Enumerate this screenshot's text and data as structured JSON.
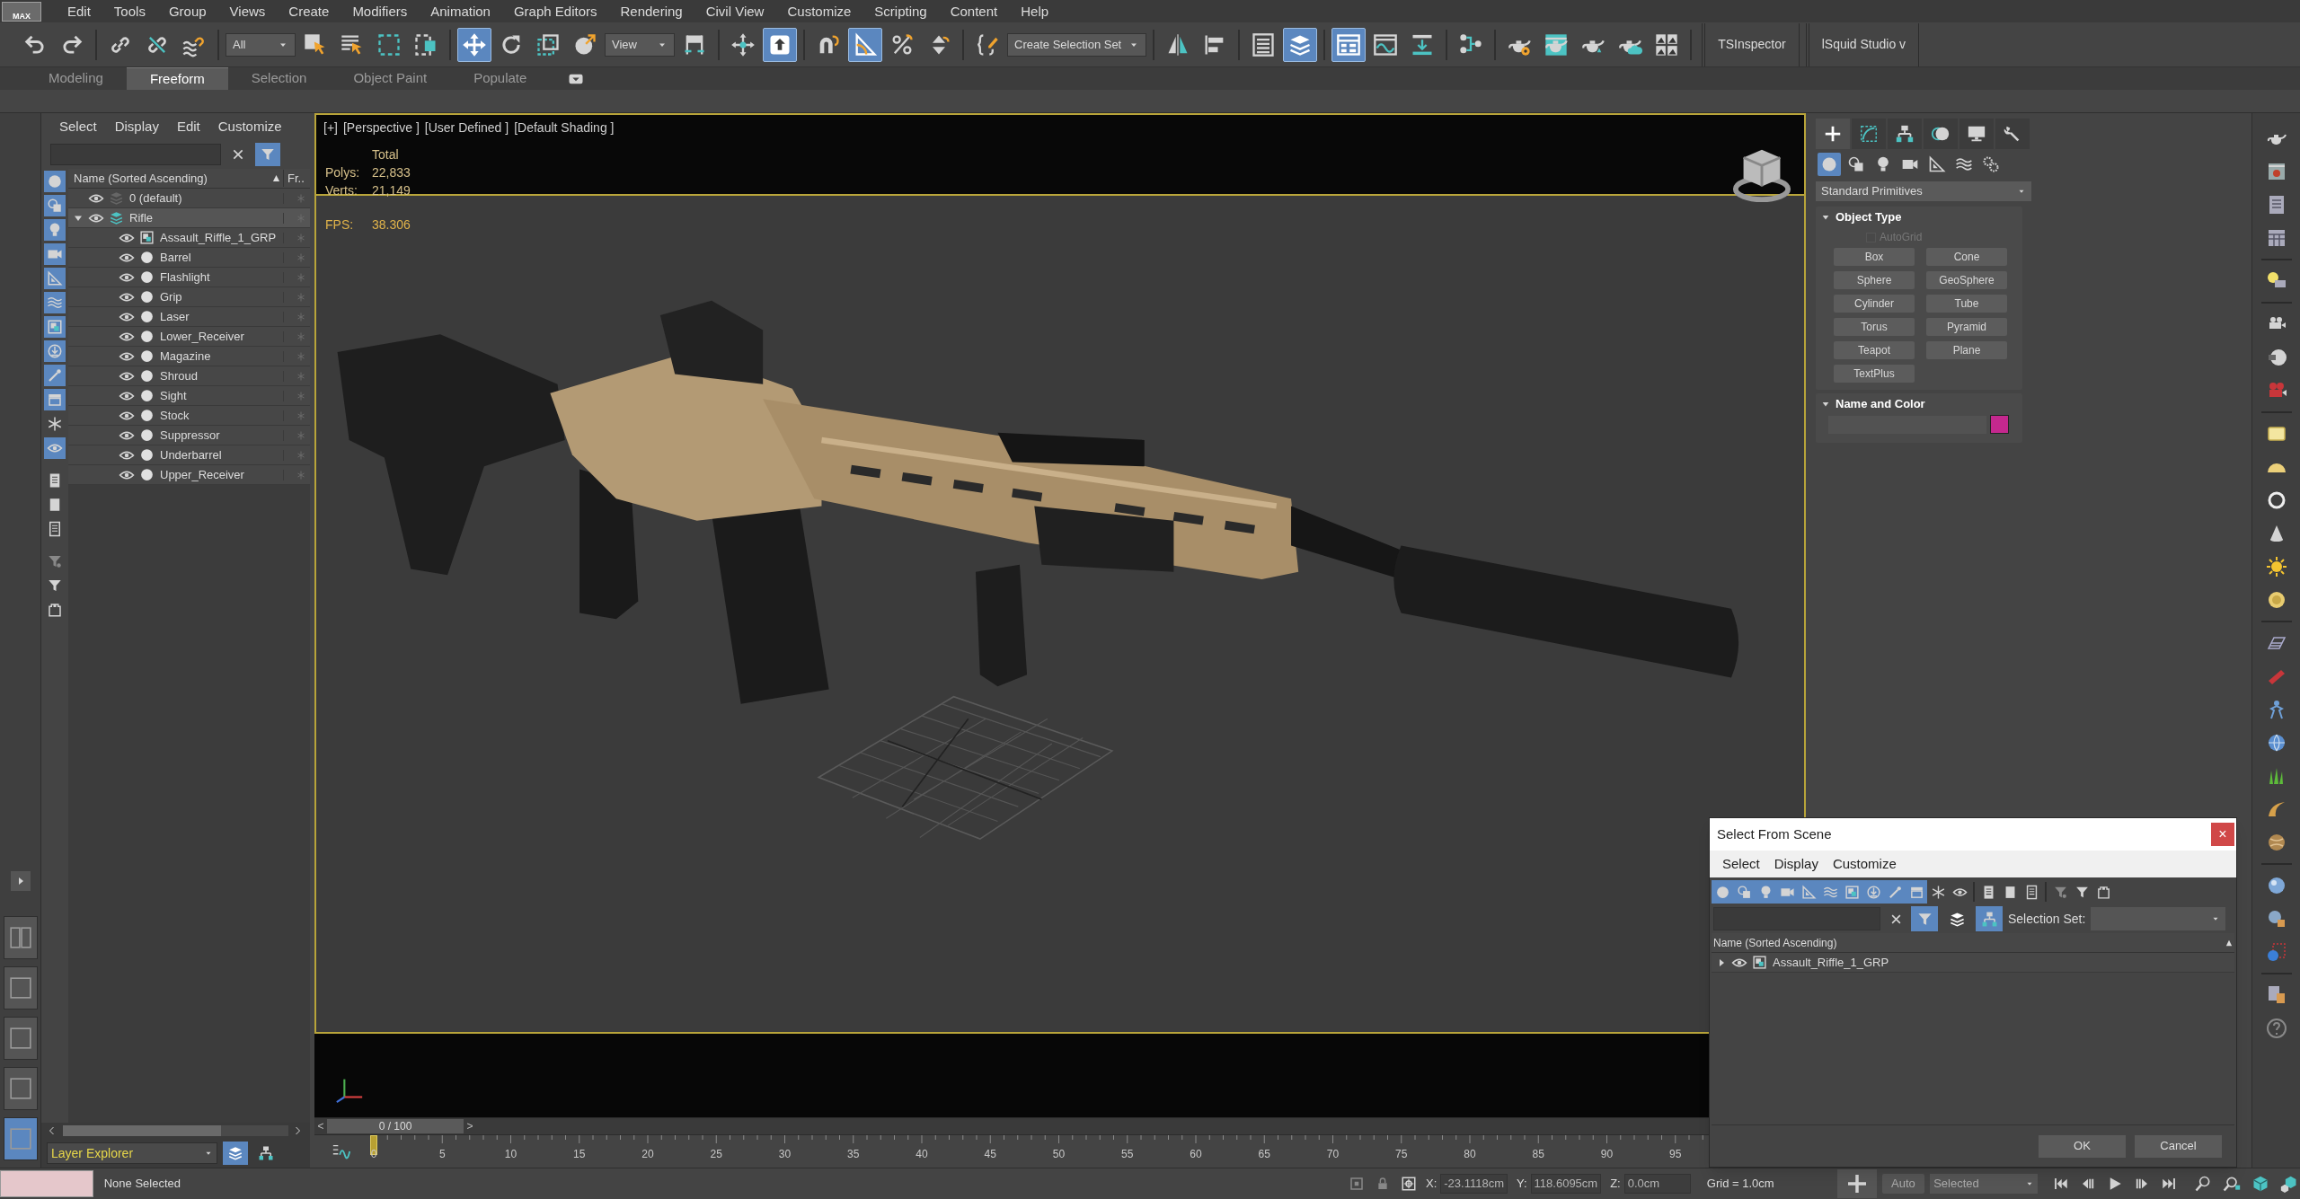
{
  "menu_bar": {
    "logo": "MAX",
    "items": [
      "Edit",
      "Tools",
      "Group",
      "Views",
      "Create",
      "Modifiers",
      "Animation",
      "Graph Editors",
      "Rendering",
      "Civil View",
      "Customize",
      "Scripting",
      "Content",
      "Help"
    ]
  },
  "main_toolbar": {
    "items": [
      {
        "kind": "undo",
        "active": false
      },
      {
        "kind": "redo",
        "active": false
      },
      {
        "kind": "separator"
      },
      {
        "kind": "link",
        "active": false
      },
      {
        "kind": "unlink",
        "active": false
      },
      {
        "kind": "bind",
        "active": false
      },
      {
        "kind": "separator"
      },
      {
        "kind": "dropdown",
        "value": "All"
      },
      {
        "kind": "select",
        "active": false
      },
      {
        "kind": "selname",
        "active": false
      },
      {
        "kind": "rect",
        "active": false
      },
      {
        "kind": "crossing",
        "active": false
      },
      {
        "kind": "separator"
      },
      {
        "kind": "move",
        "active": true
      },
      {
        "kind": "rotate",
        "active": false
      },
      {
        "kind": "scale",
        "active": false
      },
      {
        "kind": "place",
        "active": false
      },
      {
        "kind": "dropdown",
        "value": "View"
      },
      {
        "kind": "pivot",
        "active": false
      },
      {
        "kind": "separator"
      },
      {
        "kind": "manip",
        "active": false
      },
      {
        "kind": "kbd",
        "active": true
      },
      {
        "kind": "separator"
      },
      {
        "kind": "snap",
        "active": false
      },
      {
        "kind": "angle",
        "active": true
      },
      {
        "kind": "percent",
        "active": false
      },
      {
        "kind": "spinner",
        "active": false
      },
      {
        "kind": "separator"
      },
      {
        "kind": "braces",
        "active": false
      },
      {
        "kind": "dropdown",
        "value": "Create Selection Set"
      },
      {
        "kind": "separator"
      },
      {
        "kind": "mirror",
        "active": false
      },
      {
        "kind": "align",
        "active": false
      },
      {
        "kind": "separator"
      },
      {
        "kind": "list",
        "active": false
      },
      {
        "kind": "layers",
        "active": true
      },
      {
        "kind": "separator"
      },
      {
        "kind": "ribbon",
        "active": true
      },
      {
        "kind": "curve",
        "active": false
      },
      {
        "kind": "dope",
        "active": false
      },
      {
        "kind": "separator"
      },
      {
        "kind": "schem",
        "active": false
      },
      {
        "kind": "separator"
      },
      {
        "kind": "rsetup",
        "active": false
      },
      {
        "kind": "frame",
        "active": false
      },
      {
        "kind": "render",
        "active": false
      },
      {
        "kind": "cloud",
        "active": false
      },
      {
        "kind": "mosaic",
        "active": false
      },
      {
        "kind": "separator"
      },
      {
        "kind": "plugin",
        "label": "TSInspector"
      },
      {
        "kind": "plugin",
        "label": "lSquid Studio v"
      }
    ]
  },
  "ribbon_tabs": [
    {
      "label": "Modeling",
      "selected": false
    },
    {
      "label": "Freeform",
      "selected": true
    },
    {
      "label": "Selection",
      "selected": false
    },
    {
      "label": "Object Paint",
      "selected": false
    },
    {
      "label": "Populate",
      "selected": false
    }
  ],
  "viewport_layouts": [
    {
      "kind": "split",
      "selected": false
    },
    {
      "kind": "single",
      "selected": false
    },
    {
      "kind": "single",
      "selected": false
    },
    {
      "kind": "single",
      "selected": false
    },
    {
      "kind": "single",
      "selected": true
    }
  ],
  "scene_explorer": {
    "menu": [
      "Select",
      "Display",
      "Edit",
      "Customize"
    ],
    "filters": [
      {
        "kind": "geom",
        "on": true
      },
      {
        "kind": "shapes",
        "on": true
      },
      {
        "kind": "light",
        "on": true
      },
      {
        "kind": "camera",
        "on": true
      },
      {
        "kind": "helper",
        "on": true
      },
      {
        "kind": "warp",
        "on": true
      },
      {
        "kind": "group",
        "on": true
      },
      {
        "kind": "xref",
        "on": true
      },
      {
        "kind": "bone",
        "on": true
      },
      {
        "kind": "container",
        "on": true
      },
      {
        "kind": "frozen",
        "on": false
      },
      {
        "kind": "hidden",
        "on": true
      },
      {
        "kind": "doc",
        "on": false
      },
      {
        "kind": "square",
        "on": false
      },
      {
        "kind": "doc2",
        "on": false
      },
      {
        "kind": "filtergear",
        "on": false
      },
      {
        "kind": "filter",
        "on": false
      },
      {
        "kind": "tag",
        "on": false
      }
    ],
    "columns": [
      "Name (Sorted Ascending)",
      "Fr.."
    ],
    "tree": [
      {
        "name": "0 (default)",
        "kind": "layer",
        "active": false,
        "visible": true
      },
      {
        "name": "Rifle",
        "kind": "layer",
        "active": true,
        "visible": true,
        "expanded": true,
        "children": [
          {
            "name": "Assault_Riffle_1_GRP",
            "kind": "group",
            "visible": true
          },
          {
            "name": "Barrel",
            "kind": "object",
            "visible": true
          },
          {
            "name": "Flashlight",
            "kind": "object",
            "visible": true
          },
          {
            "name": "Grip",
            "kind": "object",
            "visible": true
          },
          {
            "name": "Laser",
            "kind": "object",
            "visible": true
          },
          {
            "name": "Lower_Receiver",
            "kind": "object",
            "visible": true
          },
          {
            "name": "Magazine",
            "kind": "object",
            "visible": true
          },
          {
            "name": "Shroud",
            "kind": "object",
            "visible": true
          },
          {
            "name": "Sight",
            "kind": "object",
            "visible": true
          },
          {
            "name": "Stock",
            "kind": "object",
            "visible": true
          },
          {
            "name": "Suppressor",
            "kind": "object",
            "visible": true
          },
          {
            "name": "Underbarrel",
            "kind": "object",
            "visible": true
          },
          {
            "name": "Upper_Receiver",
            "kind": "object",
            "visible": true
          }
        ]
      }
    ],
    "explorer_type": "Layer Explorer"
  },
  "viewport": {
    "labels": [
      "[+]",
      "[Perspective ]",
      "[User Defined ]",
      "[Default Shading ]"
    ],
    "stats_header": "Total",
    "stats": [
      {
        "label": "Polys:",
        "value": "22,833"
      },
      {
        "label": "Verts:",
        "value": "21,149"
      }
    ],
    "fps": {
      "label": "FPS:",
      "value": "38.306"
    }
  },
  "command_panel": {
    "tabs": [
      {
        "kind": "create",
        "selected": true
      },
      {
        "kind": "modify",
        "selected": false
      },
      {
        "kind": "hierarchy",
        "selected": false
      },
      {
        "kind": "motion",
        "selected": false
      },
      {
        "kind": "display",
        "selected": false
      },
      {
        "kind": "utilities",
        "selected": false
      }
    ],
    "categories": [
      {
        "kind": "geom",
        "selected": true
      },
      {
        "kind": "shapes",
        "selected": false
      },
      {
        "kind": "light",
        "selected": false
      },
      {
        "kind": "camera",
        "selected": false
      },
      {
        "kind": "helper",
        "selected": false
      },
      {
        "kind": "warp",
        "selected": false
      },
      {
        "kind": "systems",
        "selected": false
      }
    ],
    "category_dropdown": "Standard Primitives",
    "object_type": {
      "title": "Object Type",
      "expanded": true,
      "autogrid": {
        "label": "AutoGrid",
        "checked": false,
        "disabled": true
      },
      "buttons": [
        "Box",
        "Cone",
        "Sphere",
        "GeoSphere",
        "Cylinder",
        "Tube",
        "Torus",
        "Pyramid",
        "Teapot",
        "Plane",
        "TextPlus"
      ]
    },
    "name_and_color": {
      "title": "Name and Color",
      "expanded": true,
      "color": "#c4288e"
    }
  },
  "right_toolbar": [
    {
      "kind": "teapot"
    },
    {
      "kind": "renderwin"
    },
    {
      "kind": "winlist"
    },
    {
      "kind": "wingrid"
    },
    {
      "kind": "separator"
    },
    {
      "kind": "bulbpanel"
    },
    {
      "kind": "separator"
    },
    {
      "kind": "filmcam"
    },
    {
      "kind": "cammoon"
    },
    {
      "kind": "camred"
    },
    {
      "kind": "separator"
    },
    {
      "kind": "note"
    },
    {
      "kind": "dome"
    },
    {
      "kind": "ring"
    },
    {
      "kind": "cone"
    },
    {
      "kind": "sun"
    },
    {
      "kind": "disc"
    },
    {
      "kind": "separator"
    },
    {
      "kind": "plane"
    },
    {
      "kind": "comb"
    },
    {
      "kind": "figure"
    },
    {
      "kind": "globe"
    },
    {
      "kind": "grass"
    },
    {
      "kind": "hair"
    },
    {
      "kind": "ball"
    },
    {
      "kind": "separator"
    },
    {
      "kind": "sphere"
    },
    {
      "kind": "spherecursor"
    },
    {
      "kind": "dotsquare"
    },
    {
      "kind": "separator"
    },
    {
      "kind": "docswap"
    },
    {
      "kind": "help"
    }
  ],
  "time_slider": {
    "position": "0 / 100",
    "prev": "<",
    "next": ">",
    "level": 0
  },
  "track_bar": {
    "ticks": [
      "0",
      "5",
      "10",
      "15",
      "20",
      "25",
      "30",
      "35",
      "40",
      "45",
      "50",
      "55",
      "60",
      "65",
      "70",
      "75",
      "80",
      "85",
      "90",
      "95"
    ]
  },
  "status_bar": {
    "selection": "None Selected",
    "coords": [
      {
        "axis": "X:",
        "value": "-23.1118cm"
      },
      {
        "axis": "Y:",
        "value": "118.6095cm"
      },
      {
        "axis": "Z:",
        "value": "0.0cm"
      }
    ],
    "grid": "Grid = 1.0cm",
    "key_mode": "Auto",
    "key_filter": "Selected"
  },
  "dialog": {
    "title": "Select From Scene",
    "close": "×",
    "menu": [
      "Select",
      "Display",
      "Customize"
    ],
    "filters": [
      {
        "kind": "geom",
        "on": true
      },
      {
        "kind": "shapes",
        "on": true
      },
      {
        "kind": "light",
        "on": true
      },
      {
        "kind": "camera",
        "on": true
      },
      {
        "kind": "helper",
        "on": true
      },
      {
        "kind": "warp",
        "on": true
      },
      {
        "kind": "group",
        "on": true
      },
      {
        "kind": "xref",
        "on": true
      },
      {
        "kind": "bone",
        "on": true
      },
      {
        "kind": "container",
        "on": true
      },
      {
        "kind": "frozen",
        "on": false
      },
      {
        "kind": "hidden",
        "on": false
      },
      {
        "kind": "doc",
        "on": false
      },
      {
        "kind": "square",
        "on": false
      },
      {
        "kind": "doc2",
        "on": false
      },
      {
        "kind": "filtergear",
        "on": false
      },
      {
        "kind": "filter",
        "on": false
      },
      {
        "kind": "tag",
        "on": false
      }
    ],
    "toggles": [
      {
        "kind": "filter",
        "on": true
      },
      {
        "kind": "layers",
        "on": false
      },
      {
        "kind": "hierarchy",
        "on": true
      }
    ],
    "selection_set_label": "Selection Set:",
    "column": "Name (Sorted Ascending)",
    "tree": [
      {
        "name": "Assault_Riffle_1_GRP",
        "kind": "group",
        "visible": true,
        "expanded": false
      }
    ],
    "buttons": [
      "OK",
      "Cancel"
    ]
  }
}
